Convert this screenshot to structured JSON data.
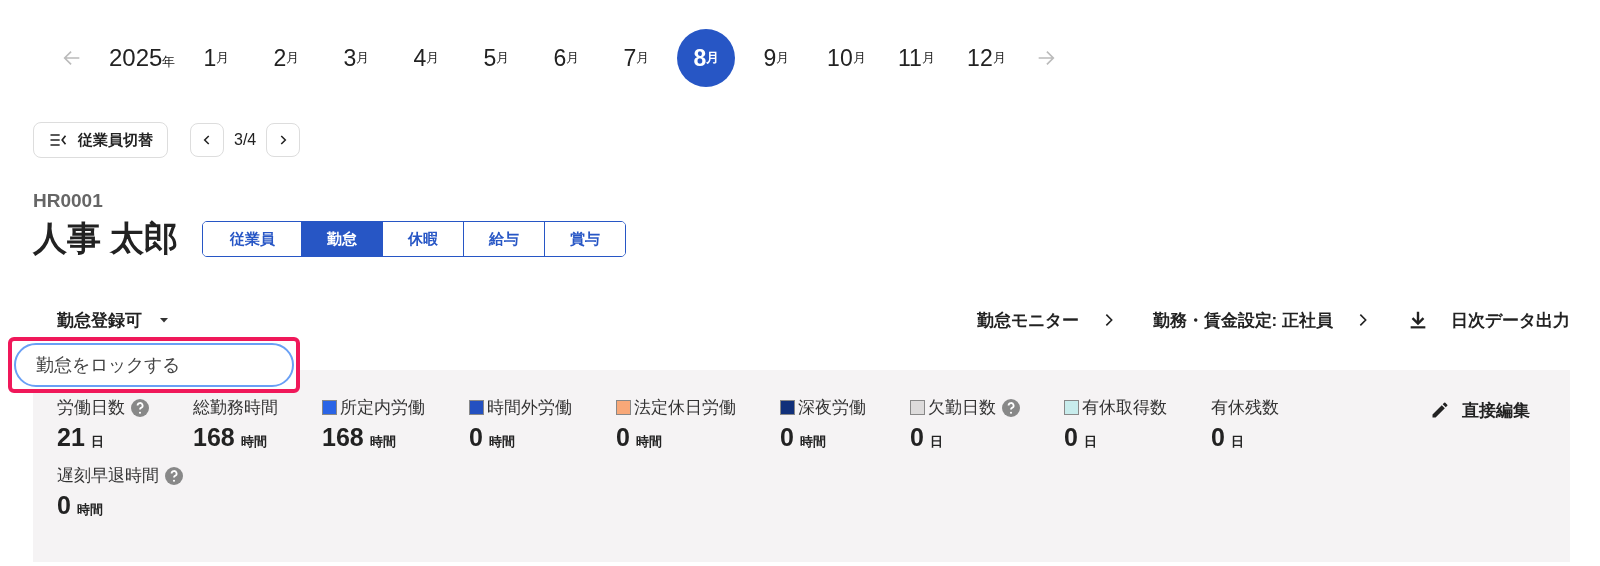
{
  "calendar": {
    "year": "2025",
    "year_unit": "年",
    "months": [
      {
        "number": "1",
        "unit": "月",
        "selected": false
      },
      {
        "number": "2",
        "unit": "月",
        "selected": false
      },
      {
        "number": "3",
        "unit": "月",
        "selected": false
      },
      {
        "number": "4",
        "unit": "月",
        "selected": false
      },
      {
        "number": "5",
        "unit": "月",
        "selected": false
      },
      {
        "number": "6",
        "unit": "月",
        "selected": false
      },
      {
        "number": "7",
        "unit": "月",
        "selected": false
      },
      {
        "number": "8",
        "unit": "月",
        "selected": true
      },
      {
        "number": "9",
        "unit": "月",
        "selected": false
      },
      {
        "number": "10",
        "unit": "月",
        "selected": false
      },
      {
        "number": "11",
        "unit": "月",
        "selected": false
      },
      {
        "number": "12",
        "unit": "月",
        "selected": false
      }
    ]
  },
  "employee_switch": {
    "label": "従業員切替"
  },
  "pager": {
    "text": "3/4"
  },
  "employee": {
    "code": "HR0001",
    "name": "人事 太郎"
  },
  "tabs": [
    {
      "label": "従業員",
      "selected": false
    },
    {
      "label": "勤怠",
      "selected": true
    },
    {
      "label": "休暇",
      "selected": false
    },
    {
      "label": "給与",
      "selected": false
    },
    {
      "label": "賞与",
      "selected": false
    }
  ],
  "status_dropdown": {
    "label": "勤怠登録可",
    "expanded": true,
    "menu": [
      {
        "label": "勤怠をロックする"
      }
    ]
  },
  "links": [
    {
      "kind": "link",
      "label": "勤怠モニター"
    },
    {
      "kind": "link",
      "label": "勤務・賃金設定: 正社員"
    },
    {
      "kind": "download",
      "label": "日次データ出力"
    }
  ],
  "stats": [
    {
      "label": "労働日数",
      "help": true,
      "value": "21",
      "unit": "日"
    },
    {
      "label": "総勤務時間",
      "value": "168",
      "unit": "時間"
    },
    {
      "label": "所定内労働",
      "color": "#2a64e6",
      "value": "168",
      "unit": "時間"
    },
    {
      "label": "時間外労働",
      "color": "#2350c0",
      "value": "0",
      "unit": "時間"
    },
    {
      "label": "法定休日労働",
      "color": "#f8a878",
      "value": "0",
      "unit": "時間"
    },
    {
      "label": "深夜労働",
      "color": "#11307a",
      "value": "0",
      "unit": "時間"
    },
    {
      "label": "欠勤日数",
      "help": true,
      "color": "#dddbdb",
      "value": "0",
      "unit": "日"
    },
    {
      "label": "有休取得数",
      "color": "#c8ecec",
      "value": "0",
      "unit": "日"
    },
    {
      "label": "有休残数",
      "value": "0",
      "unit": "日"
    },
    {
      "label": "遅刻早退時間",
      "help": true,
      "value": "0",
      "unit": "時間"
    }
  ],
  "edit_button": {
    "label": "直接編集"
  }
}
